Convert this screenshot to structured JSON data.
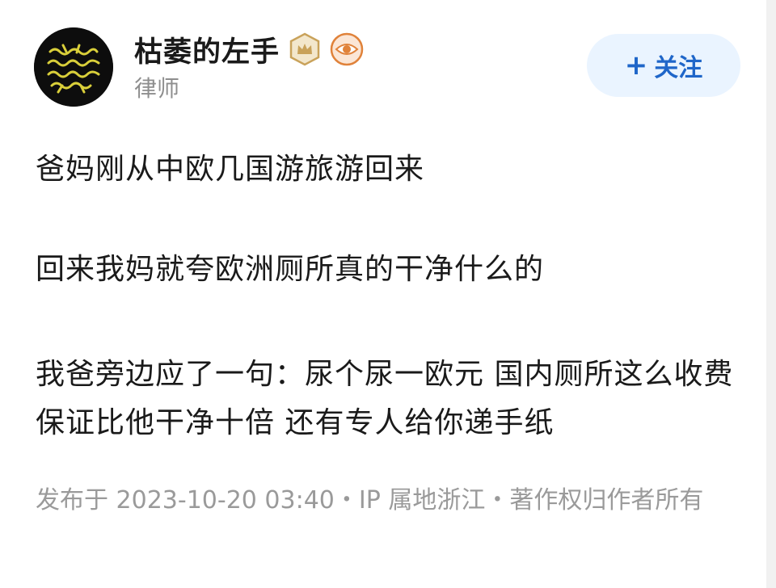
{
  "author": {
    "name": "枯萎的左手",
    "title": "律师",
    "avatar_icon": "avatar-logo-icon",
    "badges": [
      "crown-badge-icon",
      "eye-badge-icon"
    ]
  },
  "follow_button": {
    "plus": "+",
    "label": "关注"
  },
  "post": {
    "paragraphs": [
      "爸妈刚从中欧几国游旅游回来",
      "回来我妈就夸欧洲厕所真的干净什么的",
      "我爸旁边应了一句：尿个尿一欧元 国内厕所这么收费保证比他干净十倍 还有专人给你递手纸"
    ],
    "meta": "发布于 2023-10-20 03:40・IP 属地浙江・著作权归作者所有"
  },
  "colors": {
    "accent": "#1f66c9",
    "follow_bg": "#eaf4ff",
    "meta_text": "#9a9a9a",
    "badge_gold": "#c9a25a",
    "badge_orange": "#e0823a"
  }
}
